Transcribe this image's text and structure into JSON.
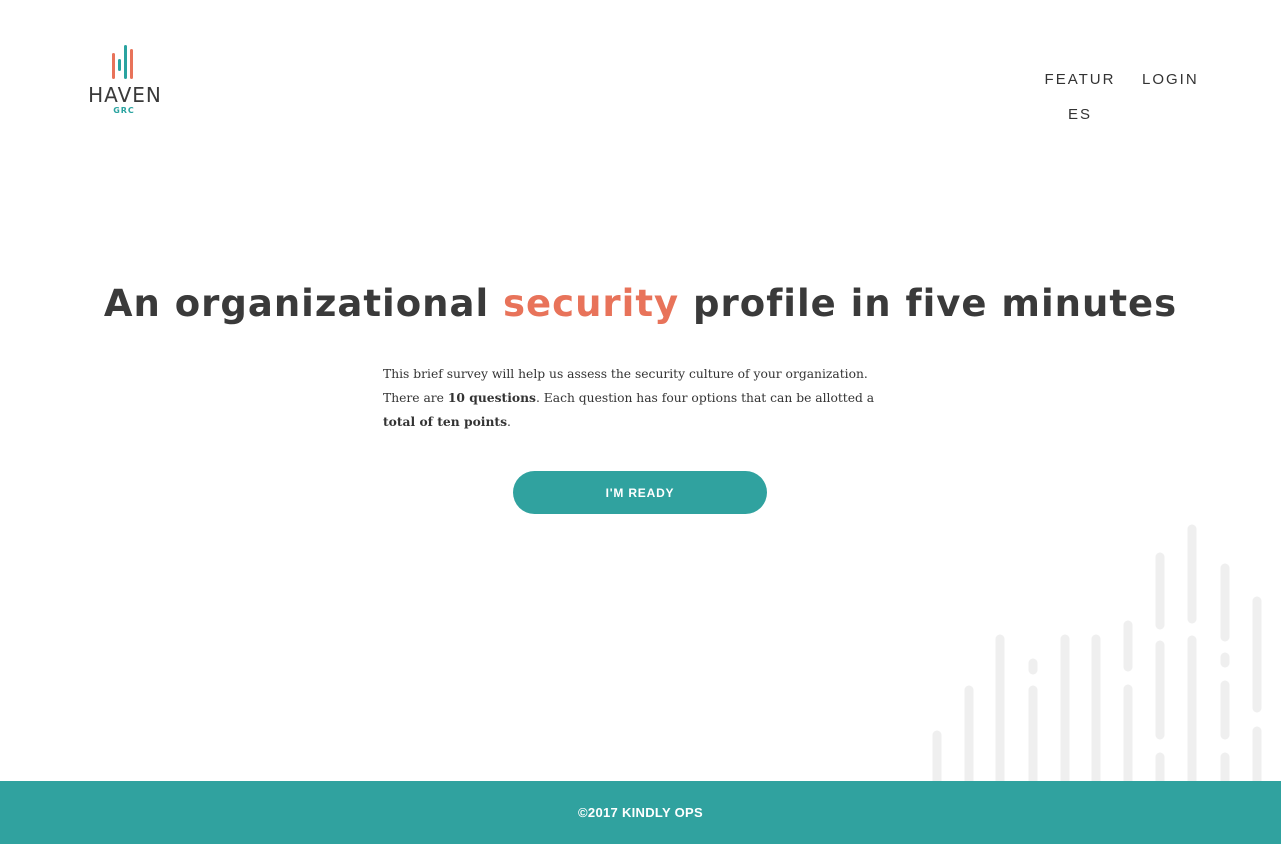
{
  "brand": {
    "name": "HAVEN",
    "sub": "GRC",
    "colors": {
      "coral": "#e8735a",
      "teal": "#2aa3a0",
      "dark": "#3a3a3a"
    }
  },
  "nav": {
    "features": "FEATURES",
    "login": "LOGIN"
  },
  "hero": {
    "title_before": "An organizational ",
    "title_accent": "security",
    "title_after": " profile in five minutes"
  },
  "intro": {
    "text1": "This brief survey will help us assess the security culture of your organization. There are ",
    "bold1": "10 questions",
    "text2": ". Each question has four options that can be allotted a ",
    "bold2": "total of ten points",
    "text3": "."
  },
  "cta": {
    "label": "I'M READY"
  },
  "decoration": {
    "name": "equalizer-bars-decoration",
    "color": "#efefef"
  },
  "footer": {
    "copyright": "©2017 KINDLY OPS"
  },
  "colors": {
    "accent": "#30a29f",
    "highlight": "#e8735a"
  }
}
